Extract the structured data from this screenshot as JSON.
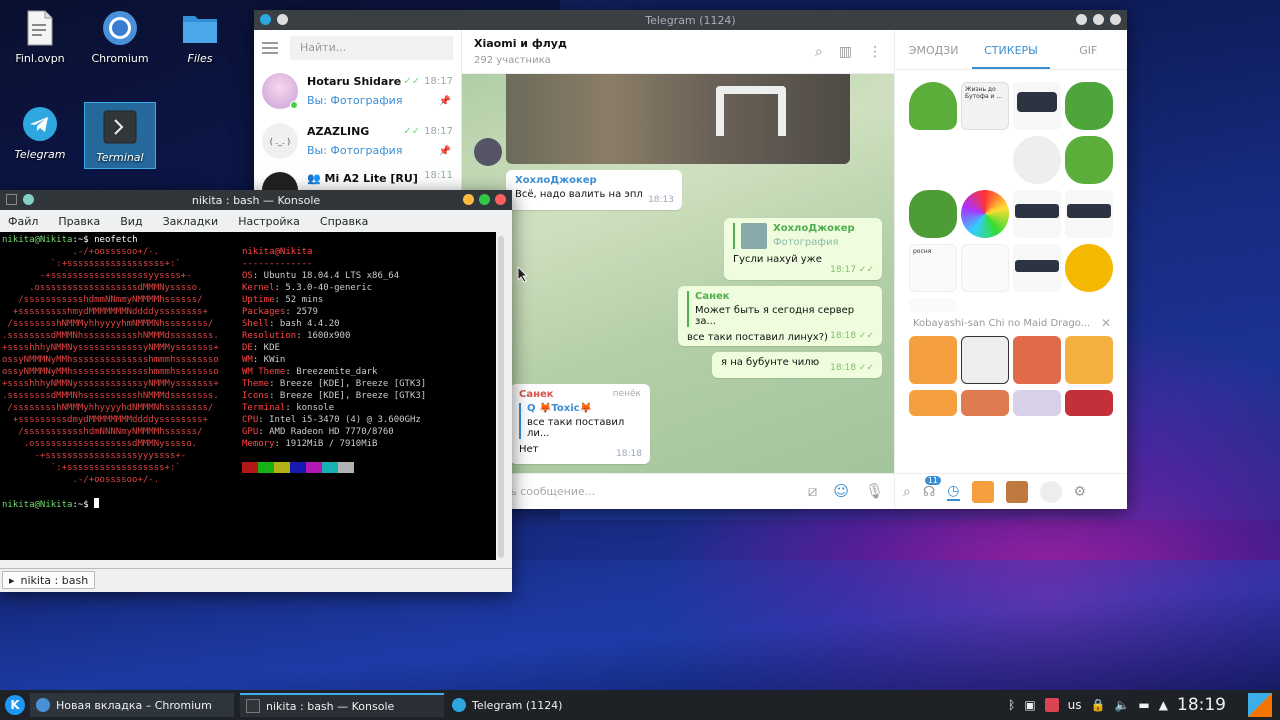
{
  "desktop": {
    "icons": [
      {
        "label": "Finl.ovpn",
        "icon": "file-icon"
      },
      {
        "label": "Chromium",
        "icon": "chromium-icon"
      },
      {
        "label": "Files",
        "icon": "folder-icon"
      },
      {
        "label": "Telegram",
        "icon": "telegram-icon"
      },
      {
        "label": "Terminal",
        "icon": "terminal-icon"
      }
    ]
  },
  "telegram": {
    "title": "Telegram (1124)",
    "search_placeholder": "Найти...",
    "chats": [
      {
        "name": "Hotaru Shidare",
        "preview": "Вы: Фотография",
        "time": "18:17"
      },
      {
        "name": "AZAZLING",
        "preview": "Вы: Фотография",
        "time": "18:17",
        "avatar_text": "( ._. )"
      },
      {
        "name": "Mi A2 Lite [RU]",
        "time": "18:11"
      }
    ],
    "current_chat": {
      "title": "Xiaomi и флуд",
      "subtitle": "292 участника"
    },
    "messages": [
      {
        "author": "ХохлоДжокер",
        "text": "Всё, надо валить на эпл",
        "time": "18:13"
      },
      {
        "quote_author": "ХохлоДжокер",
        "quote_text": "Фотография",
        "text": "Гусли нахуй уже",
        "time": "18:17"
      },
      {
        "quote_author": "Санек",
        "quote_text": "Может быть я сегодня сервер за...",
        "text": "все таки поставил линух?)",
        "time": "18:18"
      },
      {
        "text": "я на бубунте чилю",
        "time": "18:18"
      },
      {
        "author": "Санек",
        "badge": "пенёк",
        "quote_author": "Q 🦊Toxic🦊",
        "quote_text": "все таки поставил ли...",
        "text": "Нет",
        "time": "18:18"
      }
    ],
    "input_placeholder": "аписать сообщение...",
    "panel_tabs": [
      "ЭМОДЗИ",
      "СТИКЕРЫ",
      "GIF"
    ],
    "sticker_set": "Kobayashi-san Chi no Maid Drago...",
    "recent_badge": "11",
    "sticker_texts": [
      "Жизнь до Бутофа и ...",
      "росня"
    ]
  },
  "konsole": {
    "title": "nikita : bash — Konsole",
    "menu": [
      "Файл",
      "Правка",
      "Вид",
      "Закладки",
      "Настройка",
      "Справка"
    ],
    "tab": "nikita : bash",
    "prompt_user": "nikita@Nikita",
    "prompt_suffix": ":~$ ",
    "command": "neofetch",
    "logo": [
      "             .-/+oossssoo+/-.",
      "         `:+ssssssssssssssssss+:`",
      "       -+ssssssssssssssssssyyssss+-",
      "     .ossssssssssssssssssdMMMNysssso.",
      "   /ssssssssssshdmmNNmmyNMMMMhssssss/",
      "  +ssssssssshmydMMMMMMMNddddyssssssss+",
      " /sssssssshNMMMyhhyyyyhmNMMMNhssssssss/",
      ".ssssssssdMMMNhsssssssssshNMMMdssssssss.",
      "+sssshhhyNMMNyssssssssssssyNMMMysssssss+",
      "ossyNMMMNyMMhsssssssssssssshmmmhssssssso",
      "ossyNMMMNyMMhsssssssssssssshmmmhssssssso",
      "+sssshhhyNMMNyssssssssssssyNMMMysssssss+",
      ".ssssssssdMMMNhsssssssssshNMMMdssssssss.",
      " /sssssssshNMMMyhhyyyyhdNMMMNhssssssss/",
      "  +sssssssssdmydMMMMMMMMddddyssssssss+",
      "   /ssssssssssshdmNNNNmyNMMMMhssssss/",
      "    .ossssssssssssssssssdMMMNysssso.",
      "      -+sssssssssssssssssyyyssss+-",
      "         `:+ssssssssssssssssss+:`",
      "             .-/+oossssoo+/-."
    ],
    "info_header": "nikita@Nikita",
    "info_sep": "-------------",
    "info": [
      {
        "k": "OS",
        "v": "Ubuntu 18.04.4 LTS x86_64"
      },
      {
        "k": "Kernel",
        "v": "5.3.0-40-generic"
      },
      {
        "k": "Uptime",
        "v": "52 mins"
      },
      {
        "k": "Packages",
        "v": "2579"
      },
      {
        "k": "Shell",
        "v": "bash 4.4.20"
      },
      {
        "k": "Resolution",
        "v": "1600x900"
      },
      {
        "k": "DE",
        "v": "KDE"
      },
      {
        "k": "WM",
        "v": "KWin"
      },
      {
        "k": "WM Theme",
        "v": "Breezemite_dark"
      },
      {
        "k": "Theme",
        "v": "Breeze [KDE], Breeze [GTK3]"
      },
      {
        "k": "Icons",
        "v": "Breeze [KDE], Breeze [GTK3]"
      },
      {
        "k": "Terminal",
        "v": "konsole"
      },
      {
        "k": "CPU",
        "v": "Intel i5-3470 (4) @ 3.600GHz"
      },
      {
        "k": "GPU",
        "v": "AMD Radeon HD 7770/8760"
      },
      {
        "k": "Memory",
        "v": "1912MiB / 7910MiB"
      }
    ],
    "palette": [
      "#b21818",
      "#18b218",
      "#b2b218",
      "#1818b2",
      "#b218b2",
      "#18b2b2",
      "#b2b2b2"
    ]
  },
  "taskbar": {
    "tasks": [
      "Новая вкладка – Chromium",
      "nikita : bash — Konsole",
      "Telegram (1124)"
    ],
    "keyboard": "us",
    "clock": "18:19"
  }
}
